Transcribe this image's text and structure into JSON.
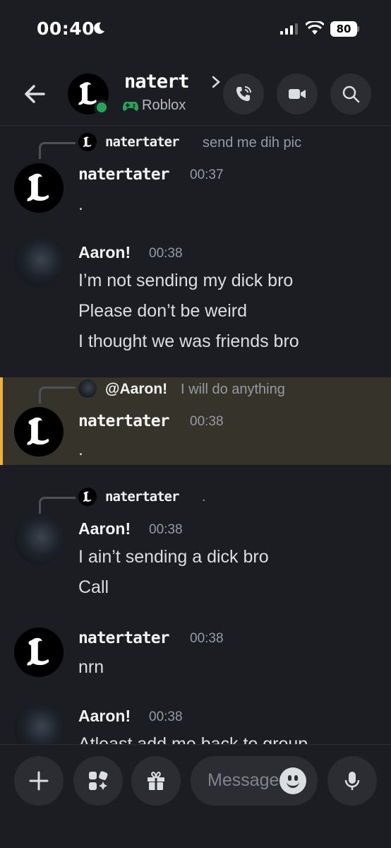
{
  "status_bar": {
    "time": "00:40",
    "battery": "80"
  },
  "header": {
    "contact_name": "natert",
    "activity": "Roblox",
    "icons": [
      "back-arrow-icon",
      "chevron-right-icon",
      "gamepad-icon",
      "phone-icon",
      "video-camera-icon",
      "search-icon"
    ]
  },
  "messages": [
    {
      "reply_to": {
        "name": "natertater",
        "text": "send me dih pic"
      },
      "author": "natertater",
      "time": "00:37",
      "lines": [
        "."
      ]
    },
    {
      "author": "Aaron!",
      "time": "00:38",
      "lines": [
        "I’m not sending my dick bro",
        "Please don’t be weird",
        "I thought we was friends bro"
      ]
    },
    {
      "reply_to": {
        "name": "@Aaron!",
        "text": "I will do anything"
      },
      "author": "natertater",
      "time": "00:38",
      "lines": [
        "."
      ],
      "highlighted": true
    },
    {
      "reply_to": {
        "name": "natertater",
        "text": "."
      },
      "author": "Aaron!",
      "time": "00:38",
      "lines": [
        "I ain’t sending a dick bro",
        "Call"
      ]
    },
    {
      "author": "natertater",
      "time": "00:38",
      "lines": [
        "nrn"
      ]
    },
    {
      "author": "Aaron!",
      "time": "00:38",
      "lines": [
        "Atleast add me back to group"
      ]
    }
  ],
  "composer": {
    "placeholder": "Message",
    "icons": [
      "plus-icon",
      "apps-icon",
      "gift-icon",
      "emoji-icon",
      "microphone-icon"
    ]
  },
  "colors": {
    "background": "#1c1d22",
    "online": "#23a55a",
    "highlight_bar": "#f0b232",
    "highlight_bg": "#36332a",
    "muted": "#949ba4"
  }
}
